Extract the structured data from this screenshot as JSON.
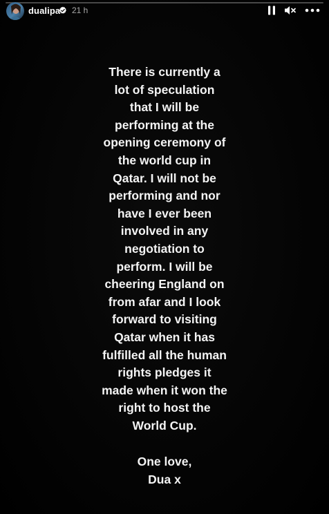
{
  "header": {
    "username": "dualipa",
    "timestamp": "21 h",
    "progress": 0
  },
  "icons": {
    "avatar": "profile-avatar",
    "verified": "verified-badge-icon",
    "pause": "pause-icon",
    "mute": "speaker-muted-icon",
    "more": "more-options-icon"
  },
  "message": {
    "lines": [
      "There is currently a",
      "lot of speculation",
      "that I will be",
      "performing at the",
      "opening ceremony of",
      "the world cup in",
      "Qatar. I will not be",
      "performing and nor",
      "have I ever been",
      "involved in any",
      "negotiation to",
      "perform. I will be",
      "cheering England on",
      "from afar and I look",
      "forward to visiting",
      "Qatar when it has",
      "fulfilled all the human",
      "rights pledges it",
      "made when it won the",
      "right to host the",
      "World Cup."
    ],
    "signoff": [
      "One love,",
      "Dua x"
    ]
  },
  "colors": {
    "background": "#000000",
    "text": "#f4f4f4",
    "verified": "#3897f0"
  }
}
